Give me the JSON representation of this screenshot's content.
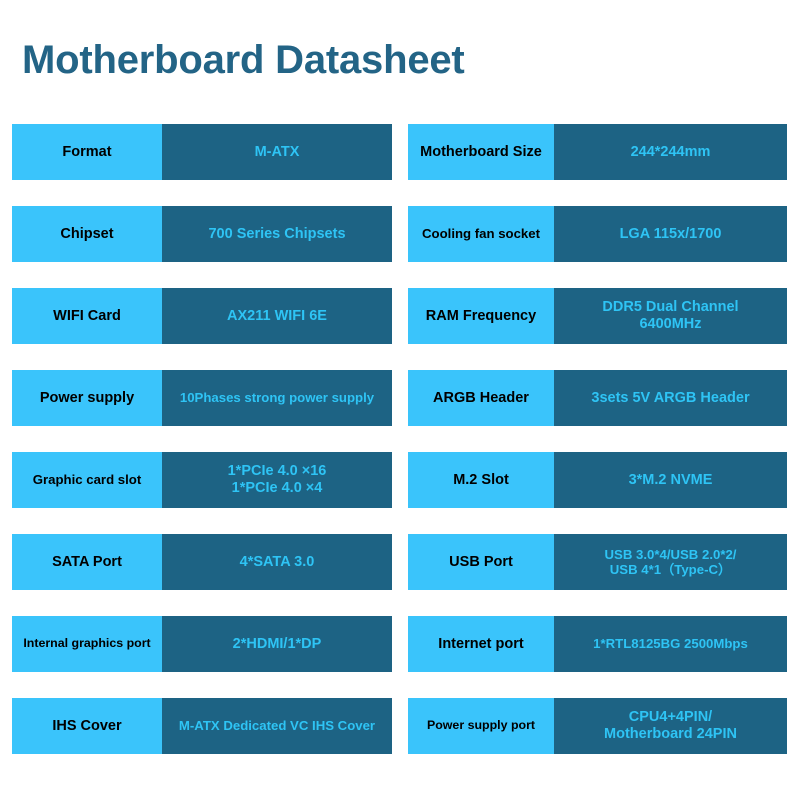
{
  "page": {
    "title": "Motherboard Datasheet",
    "colors": {
      "title_text": "#236486",
      "label_cell_bg": "#3ac4fb",
      "label_cell_text": "#000000",
      "value_cell_bg": "#1d6384",
      "value_cell_text": "#2ec4f5",
      "page_bg": "#ffffff"
    }
  },
  "spec_table": {
    "left_column": [
      {
        "label": "Format",
        "value": "M-ATX"
      },
      {
        "label": "Chipset",
        "value": "700 Series Chipsets"
      },
      {
        "label": "WIFI Card",
        "value": "AX211 WIFI 6E"
      },
      {
        "label": "Power supply",
        "value": "10Phases strong power supply"
      },
      {
        "label": "Graphic card slot",
        "value": "1*PCIe 4.0 ×16\n1*PCIe 4.0 ×4"
      },
      {
        "label": "SATA Port",
        "value": "4*SATA 3.0"
      },
      {
        "label": "Internal graphics port",
        "value": "2*HDMI/1*DP"
      },
      {
        "label": "IHS Cover",
        "value": "M-ATX Dedicated VC IHS Cover"
      }
    ],
    "right_column": [
      {
        "label": "Motherboard Size",
        "value": "244*244mm"
      },
      {
        "label": "Cooling fan socket",
        "value": "LGA 115x/1700"
      },
      {
        "label": "RAM Frequency",
        "value": "DDR5 Dual Channel\n6400MHz"
      },
      {
        "label": "ARGB Header",
        "value": "3sets 5V ARGB Header"
      },
      {
        "label": "M.2 Slot",
        "value": "3*M.2 NVME"
      },
      {
        "label": "USB Port",
        "value": "USB 3.0*4/USB 2.0*2/\nUSB 4*1（Type-C）"
      },
      {
        "label": "Internet port",
        "value": "1*RTL8125BG 2500Mbps"
      },
      {
        "label": "Power supply port",
        "value": "CPU4+4PIN/\nMotherboard 24PIN"
      }
    ]
  }
}
